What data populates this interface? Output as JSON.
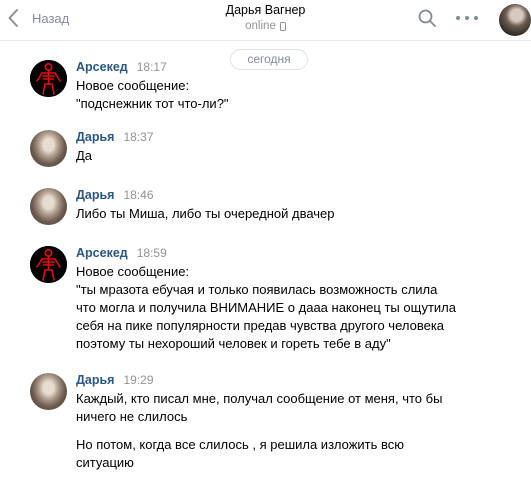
{
  "header": {
    "back_label": "Назад",
    "chat_name": "Дарья Вагнер",
    "status": "online"
  },
  "date_divider": "сегодня",
  "messages": [
    {
      "author": "Арсекед",
      "time": "18:17",
      "avatar_icon": "red-skeleton-icon",
      "texts": [
        "Новое сообщение:\n\"подснежник тот что-ли?\""
      ]
    },
    {
      "author": "Дарья",
      "time": "18:37",
      "avatar_icon": "user-photo",
      "texts": [
        "Да"
      ]
    },
    {
      "author": "Дарья",
      "time": "18:46",
      "avatar_icon": "user-photo",
      "texts": [
        "Либо ты Миша, либо ты очередной двачер"
      ]
    },
    {
      "author": "Арсекед",
      "time": "18:59",
      "avatar_icon": "red-skeleton-icon",
      "texts": [
        "Новое сообщение:\n\"ты мразота ебучая и только появилась возможность слила\nчто могла и получила ВНИМАНИЕ о дааа наконец ты ощутила\nсебя на пике популярности предав чувства другого человека\nпоэтому ты нехороший человек и гореть тебе в аду\""
      ]
    },
    {
      "author": "Дарья",
      "time": "19:29",
      "avatar_icon": "user-photo",
      "texts": [
        "Каждый, кто писал мне, получал сообщение от меня, что бы\nничего не слилось",
        "Но потом, когда все слилось , я решила изложить всю\nситуацию"
      ]
    }
  ],
  "colors": {
    "author": "#2a5885",
    "muted": "#939393",
    "icon": "#828a99",
    "skeleton": "#e01010"
  }
}
